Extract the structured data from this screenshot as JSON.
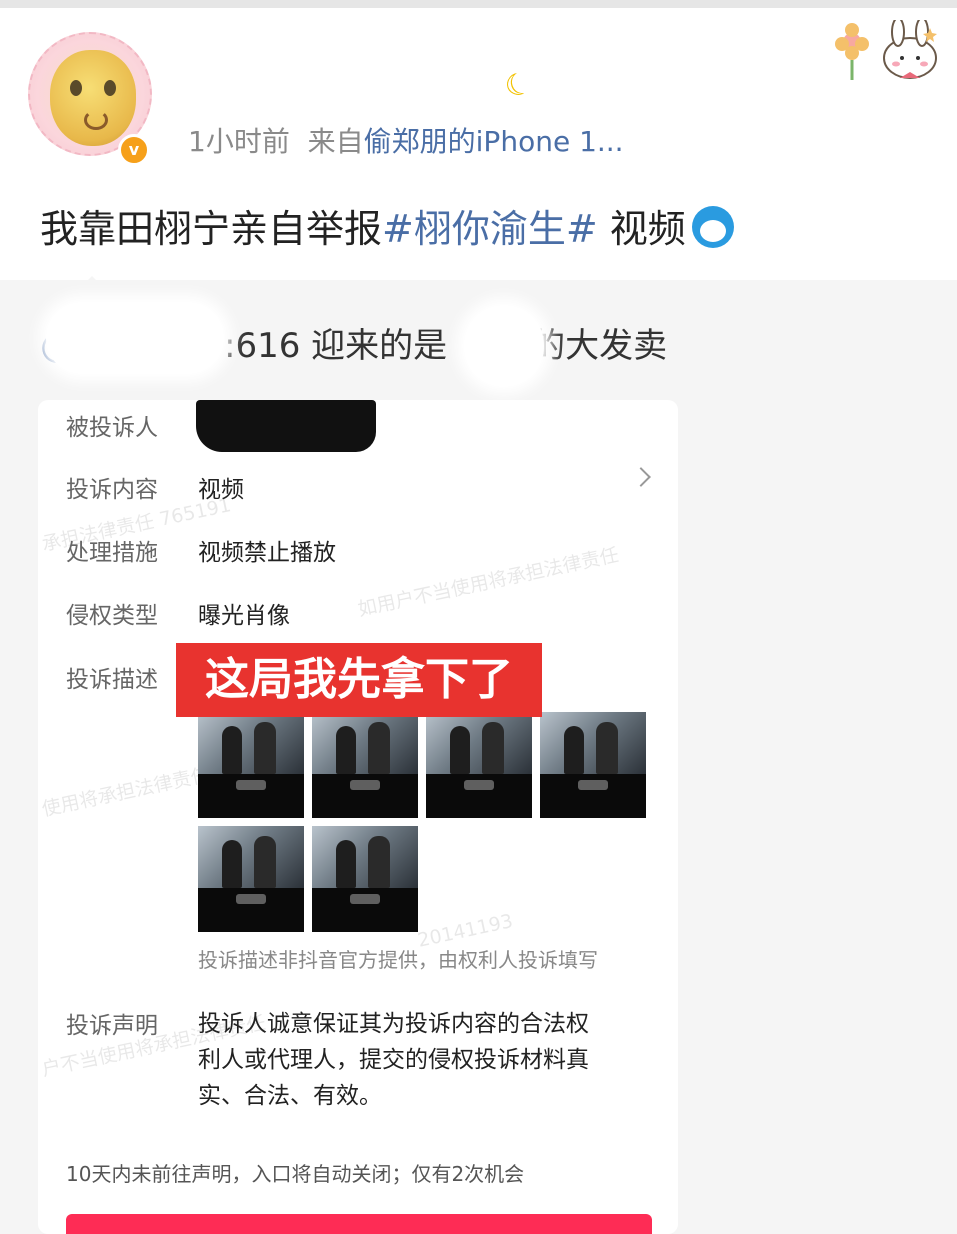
{
  "post": {
    "time": "1小时前",
    "source_prefix": "来自",
    "source": "偷郑朋的iPhone 1...",
    "text_prefix": "我靠田栩宁亲自举报",
    "topic": "#栩你渝生#",
    "text_suffix": " 视频"
  },
  "repost": {
    "at_prefix": "@",
    "text_mid": ":616 迎来的是",
    "text_end": "的大发卖"
  },
  "complaint": {
    "rows": [
      {
        "label": "被投诉人",
        "value": ""
      },
      {
        "label": "投诉内容",
        "value": "视频"
      },
      {
        "label": "处理措施",
        "value": "视频禁止播放"
      },
      {
        "label": "侵权类型",
        "value": "曝光肖像"
      },
      {
        "label": "投诉描述",
        "value": ""
      }
    ],
    "red_tag": "这局我先拿下了",
    "thumbnail_count": 6,
    "note": "投诉描述非抖音官方提供，由权利人投诉填写",
    "statement_label": "投诉声明",
    "statement_lines": [
      "投诉人诚意保证其为投诉内容的合法权",
      "利人或代理人，提交的侵权投诉材料真",
      "实、合法、有效。"
    ],
    "footer": "10天内未前往声明，入口将自动关闭；仅有2次机会",
    "watermarks": [
      "承担法律责任 765191",
      "如用户不当使用将承担法律责任",
      "使用将承担法律责任",
      "20141193",
      "户不当使用将承担法律责任"
    ]
  },
  "icons": {
    "verified": "verified-badge-icon",
    "chevron": "chevron-right-icon",
    "emoji": "doraemon-emoji-icon",
    "banana": "banana-icon"
  },
  "colors": {
    "link": "#4a6ea6",
    "red_tag": "#e8332f",
    "cta": "#fe2c55",
    "badge": "#f6a01a"
  }
}
